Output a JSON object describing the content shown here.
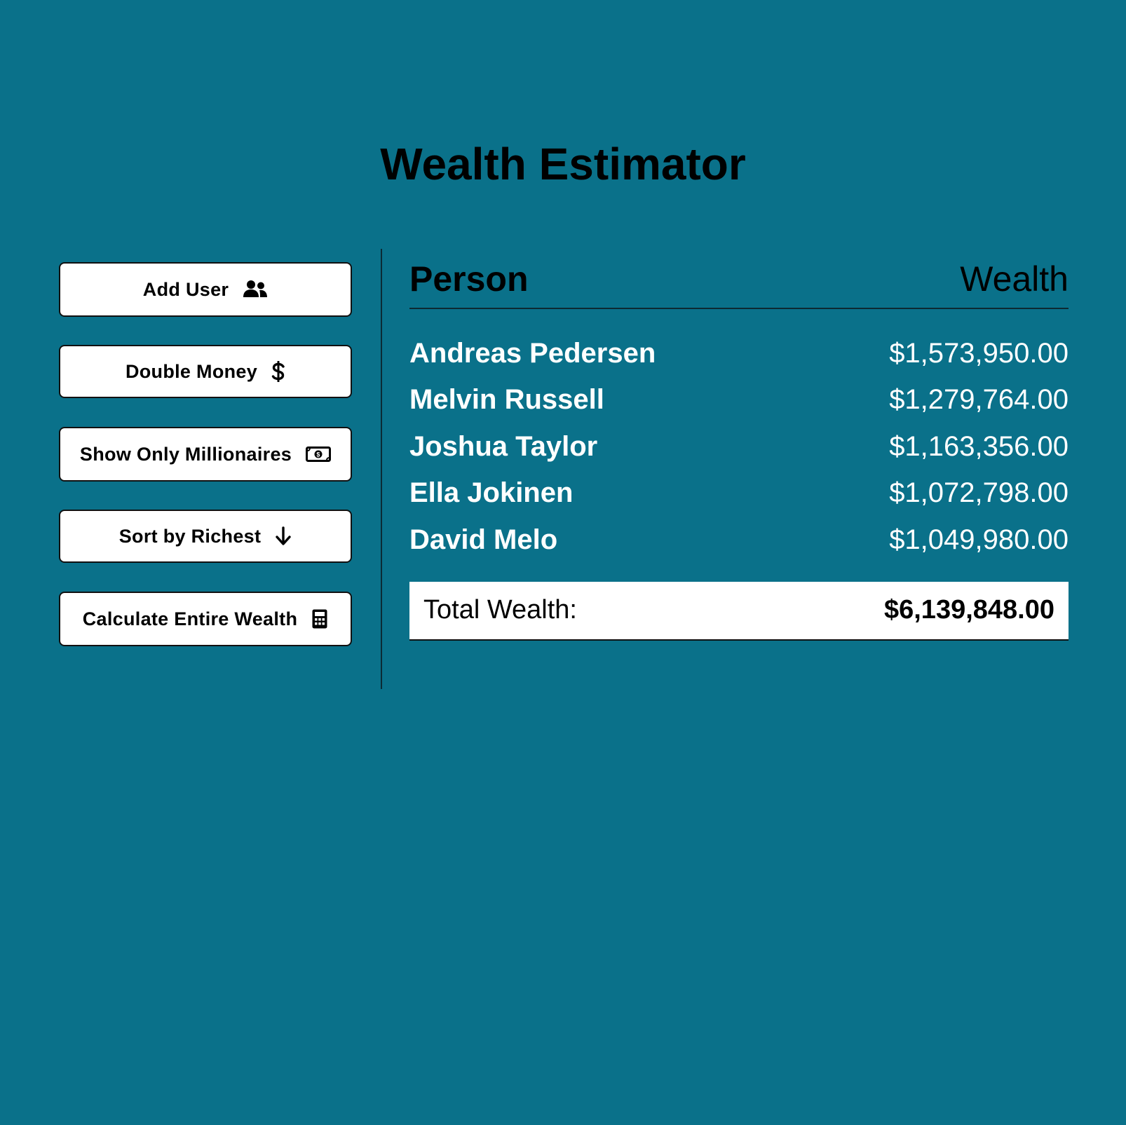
{
  "app": {
    "title": "Wealth Estimator",
    "background_color": "#0a718a"
  },
  "controls": [
    {
      "label": "Add User",
      "icon": "users-icon"
    },
    {
      "label": "Double Money",
      "icon": "dollar-icon"
    },
    {
      "label": "Show Only Millionaires",
      "icon": "money-bill-icon"
    },
    {
      "label": "Sort by Richest",
      "icon": "arrow-down-icon"
    },
    {
      "label": "Calculate Entire Wealth",
      "icon": "calculator-icon"
    }
  ],
  "table": {
    "headers": {
      "person": "Person",
      "wealth": "Wealth"
    },
    "rows": [
      {
        "name": "Andreas Pedersen",
        "wealth": "$1,573,950.00"
      },
      {
        "name": "Melvin Russell",
        "wealth": "$1,279,764.00"
      },
      {
        "name": "Joshua Taylor",
        "wealth": "$1,163,356.00"
      },
      {
        "name": "Ella Jokinen",
        "wealth": "$1,072,798.00"
      },
      {
        "name": "David Melo",
        "wealth": "$1,049,980.00"
      }
    ],
    "total": {
      "label": "Total Wealth:",
      "value": "$6,139,848.00"
    }
  }
}
